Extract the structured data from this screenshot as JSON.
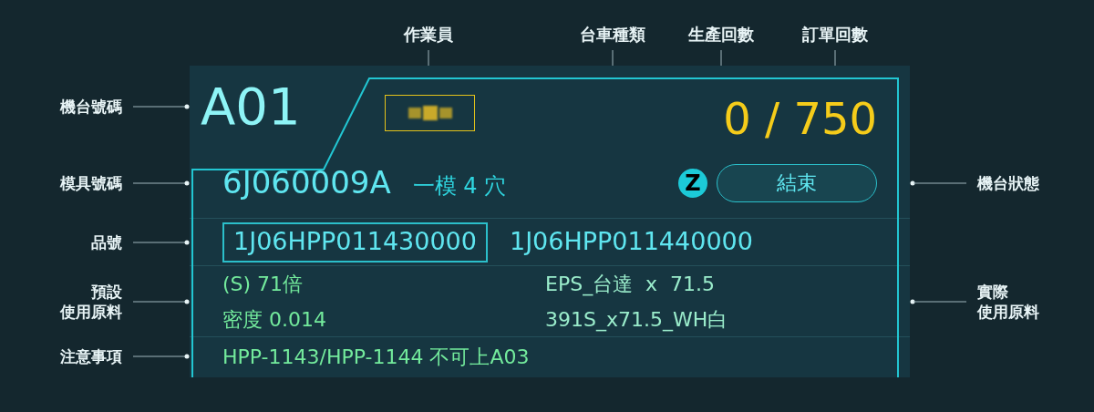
{
  "top_labels": [
    "作業員",
    "台車種類",
    "生產回數",
    "訂單回數"
  ],
  "left_labels": [
    [
      "機台號碼"
    ],
    [
      "模具號碼"
    ],
    [
      "品號"
    ],
    [
      "預設",
      "使用原料"
    ],
    [
      "注意事項"
    ]
  ],
  "right_labels": [
    [
      "機台狀態"
    ],
    [
      "實際",
      "使用原料"
    ]
  ],
  "panel": {
    "machine_no": "A01",
    "count": "0 / 750",
    "mold": "6J060009A",
    "cavity": "一模 4 穴",
    "cart_type": "Z",
    "status": "結束",
    "parts": [
      {
        "text": "1J06HPP011430000",
        "selected": true
      },
      {
        "text": "1J06HPP011440000",
        "selected": false
      }
    ],
    "preset_material": [
      "(S) 71倍",
      "密度 0.014"
    ],
    "actual_material": [
      "EPS_台達  x  71.5",
      "391S_x71.5_WH白"
    ],
    "note": "HPP-1143/HPP-1144 不可上A03"
  }
}
